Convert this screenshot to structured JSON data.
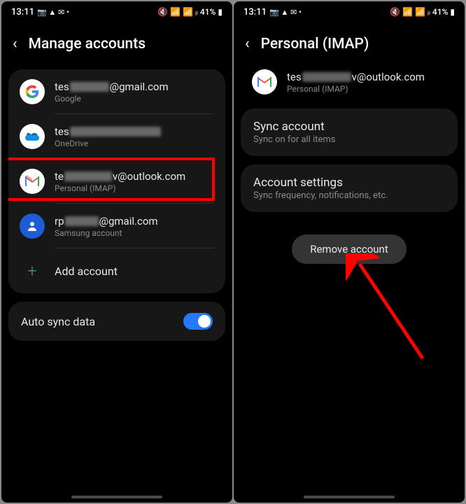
{
  "status": {
    "time": "13:11",
    "icons_left": "📷 ▲ M •",
    "icons_right": "🔇 📶 ⚡ ₁₁",
    "battery": "41%"
  },
  "screen1": {
    "title": "Manage accounts",
    "accounts": [
      {
        "prefix": "tes",
        "suffix": "@gmail.com",
        "type": "Google",
        "icon": "google"
      },
      {
        "prefix": "tes",
        "suffix": "",
        "type": "OneDrive",
        "icon": "onedrive"
      },
      {
        "prefix": "te",
        "suffix": "v@outlook.com",
        "type": "Personal (IMAP)",
        "icon": "gmail"
      },
      {
        "prefix": "rp",
        "suffix": "@gmail.com",
        "type": "Samsung account",
        "icon": "samsung"
      }
    ],
    "add_label": "Add account",
    "autosync": "Auto sync data"
  },
  "screen2": {
    "title": "Personal (IMAP)",
    "account": {
      "prefix": "tes",
      "suffix": "v@outlook.com",
      "type": "Personal (IMAP)"
    },
    "sync": {
      "title": "Sync account",
      "sub": "Sync on for all items"
    },
    "settings": {
      "title": "Account settings",
      "sub": "Sync frequency, notifications, etc."
    },
    "remove": "Remove account"
  }
}
